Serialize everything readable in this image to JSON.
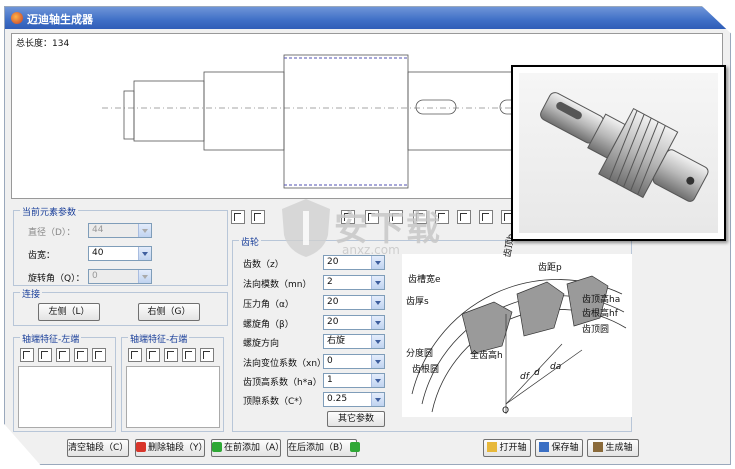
{
  "window": {
    "title": "迈迪轴生成器",
    "brand_color": "#3f6fc6"
  },
  "drawing": {
    "total_length_label": "总长度：134"
  },
  "current_params": {
    "title": "当前元素参数",
    "diameter": {
      "label": "直径（D）：",
      "value": "44"
    },
    "tooth_width": {
      "label": "齿宽：",
      "value": "40"
    },
    "rotation": {
      "label": "旋转角（Q）：",
      "value": "0"
    }
  },
  "connect": {
    "title": "连接",
    "left_button": "左侧（L）",
    "right_button": "右侧（G）"
  },
  "end_left": {
    "title": "轴端特征-左端"
  },
  "end_right": {
    "title": "轴端特征-右端"
  },
  "gear": {
    "title": "齿轮",
    "rows": [
      {
        "label": "齿数（z）",
        "value": "20"
      },
      {
        "label": "法向模数（mn）",
        "value": "2"
      },
      {
        "label": "压力角（α）",
        "value": "20"
      },
      {
        "label": "螺旋角（β）",
        "value": "20"
      },
      {
        "label": "螺旋方向",
        "value": "右旋"
      },
      {
        "label": "法向变位系数（xn）",
        "value": "0"
      },
      {
        "label": "齿顶高系数（h*a）",
        "value": "1"
      },
      {
        "label": "顶隙系数（C*）",
        "value": "0.25"
      }
    ],
    "other_params_button": "其它参数",
    "diagram_labels": {
      "pitch": "齿距p",
      "groove": "齿槽宽e",
      "thickness": "齿厚s",
      "depth_label": "齿顶b",
      "addendum": "齿顶高ha",
      "dedendum": "齿根高hf",
      "tip_circle": "齿顶圆",
      "pitch_circle": "分度圆",
      "root_circle": "齿根圆",
      "full_depth": "全齿高h",
      "d_label": "d",
      "da_label": "da",
      "df_label": "df",
      "o_label": "O"
    }
  },
  "bottom_buttons": {
    "clear": "清空轴段（C）",
    "delete": "删除轴段（Y）",
    "add_before": "在前添加（A）",
    "add_after": "在后添加（B）",
    "open": "打开轴",
    "save": "保存轴",
    "generate": "生成轴"
  },
  "watermark": {
    "main": "安下载",
    "sub": "anxz.com"
  }
}
